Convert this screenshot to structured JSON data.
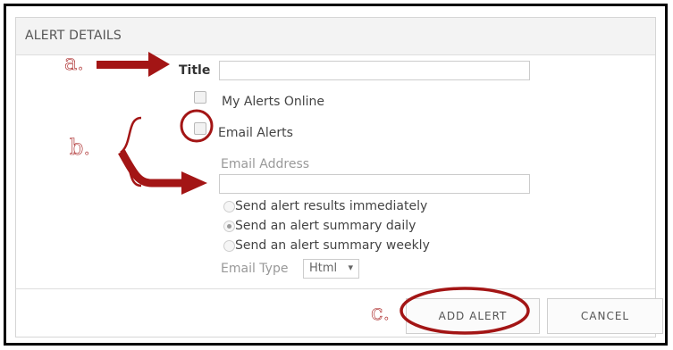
{
  "dialog": {
    "header_title": "ALERT DETAILS"
  },
  "form": {
    "title_label": "Title",
    "title_value": "",
    "my_alerts_label": "My Alerts Online",
    "email_alerts_label": "Email Alerts",
    "email_address_label": "Email Address",
    "email_address_value": "",
    "frequency_options": [
      {
        "label": "Send alert results immediately",
        "checked": false
      },
      {
        "label": "Send an alert summary daily",
        "checked": true
      },
      {
        "label": "Send an alert summary weekly",
        "checked": false
      }
    ],
    "email_type_label": "Email Type",
    "email_type_value": "Html",
    "email_type_caret": "▾"
  },
  "footer": {
    "add_alert_label": "ADD ALERT",
    "cancel_label": "CANCEL"
  },
  "annotations": {
    "a": "a.",
    "b": "b.",
    "c": "c.",
    "color": "#a31515"
  }
}
